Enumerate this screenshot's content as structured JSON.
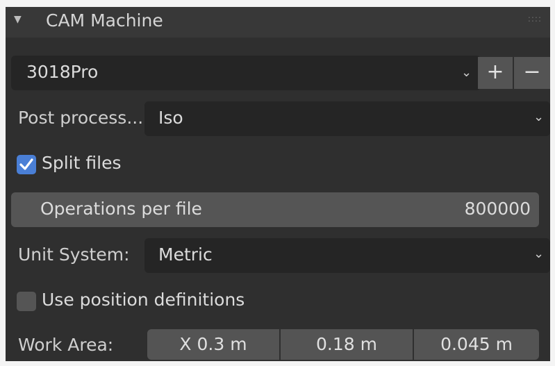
{
  "panel": {
    "title": "CAM Machine",
    "collapse_icon": "triangle-down-icon",
    "grip_icon": "drag-grip-icon",
    "grip_glyph": "::::"
  },
  "machine": {
    "preset_value": "3018Pro",
    "add_label": "+",
    "remove_label": "−"
  },
  "post_process": {
    "label": "Post process...",
    "value": "Iso"
  },
  "split_files": {
    "label": "Split files",
    "checked": true
  },
  "operations_per_file": {
    "label": "Operations per file",
    "value": "800000"
  },
  "unit_system": {
    "label": "Unit System:",
    "value": "Metric"
  },
  "use_position_definitions": {
    "label": "Use position definitions",
    "checked": false
  },
  "work_area": {
    "label": "Work Area:",
    "x": "X  0.3 m",
    "y": "0.18 m",
    "z": "0.045 m"
  },
  "colors": {
    "panel_bg": "#2f2f2f",
    "header_bg": "#383838",
    "field_dark": "#252525",
    "field_mid": "#555555",
    "accent": "#4a7fd6"
  }
}
